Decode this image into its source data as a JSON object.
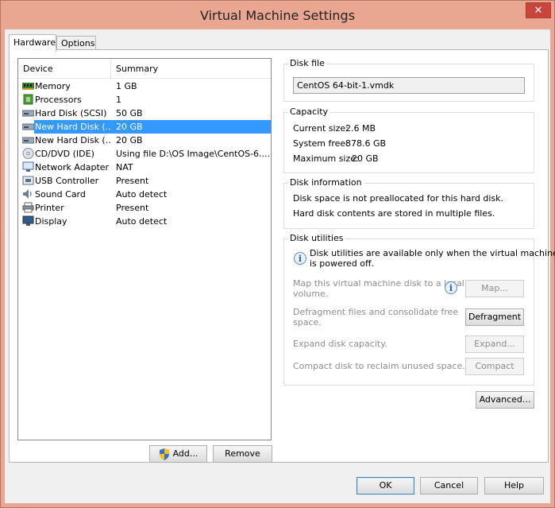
{
  "window": {
    "title": "Virtual Machine Settings",
    "close_glyph": "✕"
  },
  "tabs": [
    {
      "label": "Hardware",
      "active": true
    },
    {
      "label": "Options",
      "active": false
    }
  ],
  "devices": {
    "header": {
      "device": "Device",
      "summary": "Summary"
    },
    "rows": [
      {
        "name": "Memory",
        "summary": "1 GB",
        "icon": "memory-icon"
      },
      {
        "name": "Processors",
        "summary": "1",
        "icon": "processor-icon"
      },
      {
        "name": "Hard Disk (SCSI)",
        "summary": "50 GB",
        "icon": "hard-disk-icon"
      },
      {
        "name": "New Hard Disk (...",
        "summary": "20 GB",
        "icon": "hard-disk-icon",
        "selected": true
      },
      {
        "name": "New Hard Disk (...",
        "summary": "20 GB",
        "icon": "hard-disk-icon"
      },
      {
        "name": "CD/DVD (IDE)",
        "summary": "Using file D:\\OS Image\\CentOS-6....",
        "icon": "cd-dvd-icon"
      },
      {
        "name": "Network Adapter",
        "summary": "NAT",
        "icon": "network-adapter-icon"
      },
      {
        "name": "USB Controller",
        "summary": "Present",
        "icon": "usb-icon"
      },
      {
        "name": "Sound Card",
        "summary": "Auto detect",
        "icon": "sound-card-icon"
      },
      {
        "name": "Printer",
        "summary": "Present",
        "icon": "printer-icon"
      },
      {
        "name": "Display",
        "summary": "Auto detect",
        "icon": "display-icon"
      }
    ],
    "add_label": "Add...",
    "remove_label": "Remove"
  },
  "disk_file": {
    "title": "Disk file",
    "value": "CentOS 64-bit-1.vmdk"
  },
  "capacity": {
    "title": "Capacity",
    "current_label": "Current size:",
    "current_value": "2.6 MB",
    "free_label": "System free:",
    "free_value": "878.6 GB",
    "max_label": "Maximum size:",
    "max_value": "20 GB"
  },
  "disk_info": {
    "title": "Disk information",
    "line1": "Disk space is not preallocated for this hard disk.",
    "line2": "Hard disk contents are stored in multiple files."
  },
  "disk_utilities": {
    "title": "Disk utilities",
    "note_line1": "Disk utilities are available only when the virtual machine",
    "note_line2": "is powered off.",
    "map_text1": "Map this virtual machine disk to a local",
    "map_text2": "volume.",
    "map_button": "Map...",
    "defrag_text1": "Defragment files and consolidate free",
    "defrag_text2": "space.",
    "defrag_button": "Defragment",
    "expand_text": "Expand disk capacity.",
    "expand_button": "Expand...",
    "compact_text": "Compact disk to reclaim unused space.",
    "compact_button": "Compact"
  },
  "advanced_label": "Advanced...",
  "footer": {
    "ok": "OK",
    "cancel": "Cancel",
    "help": "Help"
  }
}
